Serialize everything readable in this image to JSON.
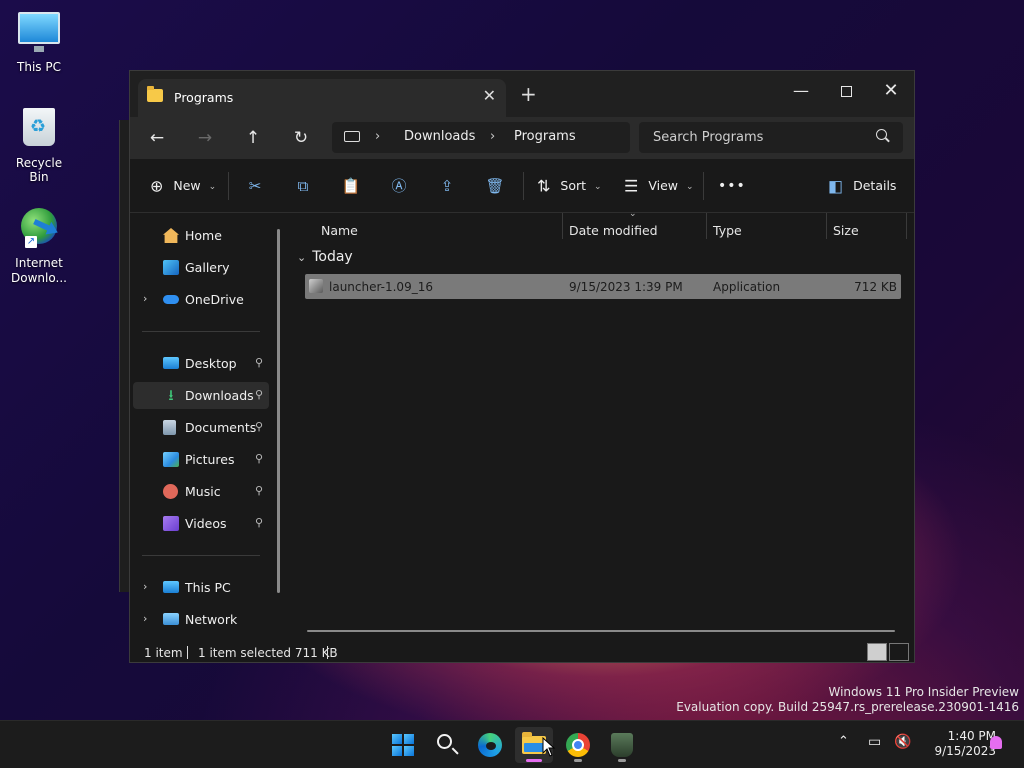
{
  "desktop": {
    "icons": [
      {
        "label": "This PC"
      },
      {
        "label": "Recycle Bin"
      },
      {
        "label": "Internet Downlo..."
      }
    ]
  },
  "window": {
    "tab_title": "Programs",
    "close_tab_glyph": "✕",
    "new_tab_glyph": "+",
    "controls": {
      "minimize": "—",
      "close": "✕"
    }
  },
  "navigation": {
    "back": "←",
    "forward": "→",
    "up": "↑",
    "refresh": "↻",
    "breadcrumb": [
      "Downloads",
      "Programs"
    ],
    "chevron": "›",
    "search_placeholder": "Search Programs"
  },
  "toolbar": {
    "new_label": "New",
    "sort_label": "Sort",
    "view_label": "View",
    "more_label": "•••",
    "details_label": "Details",
    "icons": {
      "new": "⊕",
      "cut": "✂",
      "copy": "⧉",
      "paste": "📋",
      "rename": "Ⓐ",
      "share": "⇪",
      "delete": "🗑",
      "sort": "⇅",
      "view": "☰",
      "details": "◧"
    }
  },
  "sidebar": {
    "items": [
      {
        "label": "Home",
        "icon": "home-icon",
        "expandable": false,
        "pinned": false
      },
      {
        "label": "Gallery",
        "icon": "gallery-icon",
        "expandable": false,
        "pinned": false
      },
      {
        "label": "OneDrive",
        "icon": "onedrive-icon",
        "expandable": true,
        "pinned": false
      },
      {
        "label": "Desktop",
        "icon": "desktop-icon",
        "expandable": false,
        "pinned": true
      },
      {
        "label": "Downloads",
        "icon": "downloads-icon",
        "expandable": false,
        "pinned": true,
        "selected": true
      },
      {
        "label": "Documents",
        "icon": "documents-icon",
        "expandable": false,
        "pinned": true
      },
      {
        "label": "Pictures",
        "icon": "pictures-icon",
        "expandable": false,
        "pinned": true
      },
      {
        "label": "Music",
        "icon": "music-icon",
        "expandable": false,
        "pinned": true
      },
      {
        "label": "Videos",
        "icon": "videos-icon",
        "expandable": false,
        "pinned": true
      },
      {
        "label": "This PC",
        "icon": "this-pc-icon",
        "expandable": true,
        "pinned": false
      },
      {
        "label": "Network",
        "icon": "network-icon",
        "expandable": true,
        "pinned": false
      }
    ],
    "expand_glyph": "›",
    "pin_glyph": "📌"
  },
  "file_list": {
    "columns": [
      "Name",
      "Date modified",
      "Type",
      "Size"
    ],
    "group": "Today",
    "group_chevron": "⌄",
    "rows": [
      {
        "name": "launcher-1.09_16",
        "date": "9/15/2023 1:39 PM",
        "type": "Application",
        "size": "712 KB",
        "selected": true
      }
    ]
  },
  "status": {
    "count": "1 item",
    "selected": "1 item selected  711 KB"
  },
  "watermark": {
    "line1": "Windows 11 Pro Insider Preview",
    "line2": "Evaluation copy. Build 25947.rs_prerelease.230901-1416"
  },
  "taskbar": {
    "apps": [
      "start",
      "search",
      "edge",
      "file-explorer",
      "chrome",
      "launcher"
    ],
    "tray_chevron": "⌃",
    "time": "1:40 PM",
    "date": "9/15/2023"
  },
  "colors": {
    "accent": "#e56df0",
    "window_bg": "#191919",
    "titlebar_bg": "#202020",
    "selection": "#7a7a7a"
  }
}
